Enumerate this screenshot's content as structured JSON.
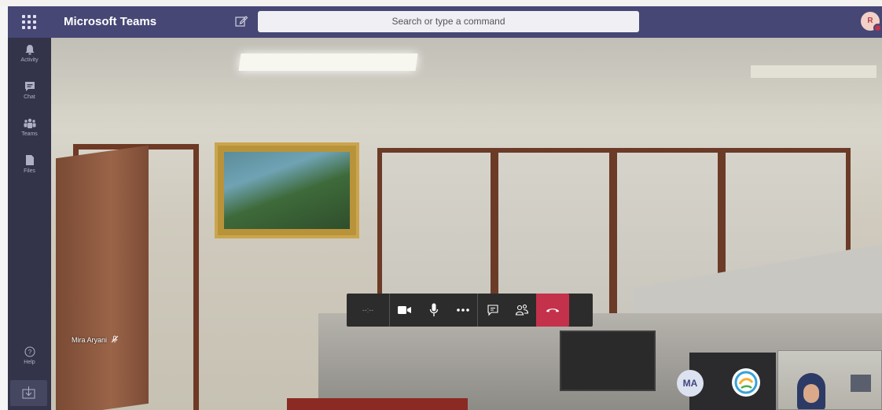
{
  "app": {
    "title": "Microsoft Teams",
    "search_placeholder": "Search or type a command",
    "user_initial": "R"
  },
  "rail": {
    "items": [
      {
        "label": "Activity",
        "icon": "bell-icon"
      },
      {
        "label": "Chat",
        "icon": "chat-icon"
      },
      {
        "label": "Teams",
        "icon": "teams-icon"
      },
      {
        "label": "Files",
        "icon": "file-icon"
      }
    ],
    "help_label": "Help"
  },
  "call": {
    "participant_name": "Mira Aryani",
    "timer": "--:--",
    "roster_initials": "MA",
    "colors": {
      "hangup": "#c4314b",
      "header": "#464775",
      "rail": "#33344a"
    }
  }
}
